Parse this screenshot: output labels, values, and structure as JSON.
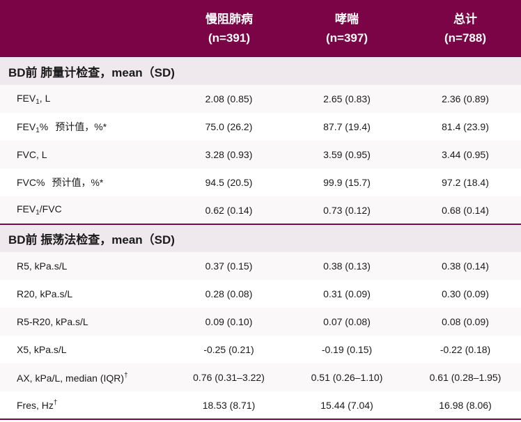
{
  "header": {
    "col1_line1": "慢阻肺病",
    "col1_line2": "(n=391)",
    "col2_line1": "哮喘",
    "col2_line2": "(n=397)",
    "col3_line1": "总计",
    "col3_line2": "(n=788)"
  },
  "section1": {
    "title": "BD前 肺量计检查，mean（SD)"
  },
  "section2": {
    "title": "BD前 振荡法检查，mean（SD)"
  },
  "rows1": [
    {
      "label_a": "FEV",
      "label_sub": "1",
      "label_b": ", L",
      "v1": "2.08 (0.85)",
      "v2": "2.65 (0.83)",
      "v3": "2.36 (0.89)"
    },
    {
      "label_a": "FEV",
      "label_sub": "1",
      "label_b": "%",
      "label_suffix": "预计值，%*",
      "v1": "75.0 (26.2)",
      "v2": "87.7 (19.4)",
      "v3": "81.4 (23.9)"
    },
    {
      "label_a": "FVC, L",
      "v1": "3.28 (0.93)",
      "v2": "3.59 (0.95)",
      "v3": "3.44 (0.95)"
    },
    {
      "label_a": "FVC%",
      "label_suffix": "预计值，%*",
      "v1": "94.5 (20.5)",
      "v2": "99.9 (15.7)",
      "v3": "97.2 (18.4)"
    },
    {
      "label_a": "FEV",
      "label_sub": "1",
      "label_b": "/FVC",
      "v1": "0.62 (0.14)",
      "v2": "0.73 (0.12)",
      "v3": "0.68 (0.14)"
    }
  ],
  "rows2": [
    {
      "label_a": "R5, kPa.s/L",
      "v1": "0.37 (0.15)",
      "v2": "0.38 (0.13)",
      "v3": "0.38 (0.14)"
    },
    {
      "label_a": "R20, kPa.s/L",
      "v1": "0.28 (0.08)",
      "v2": "0.31 (0.09)",
      "v3": "0.30 (0.09)"
    },
    {
      "label_a": "R5-R20, kPa.s/L",
      "v1": "0.09 (0.10)",
      "v2": "0.07 (0.08)",
      "v3": "0.08 (0.09)"
    },
    {
      "label_a": "X5, kPa.s/L",
      "v1": "-0.25 (0.21)",
      "v2": "-0.19 (0.15)",
      "v3": "-0.22 (0.18)"
    },
    {
      "label_a": "AX, kPa/L, median (IQR)",
      "label_sup": "†",
      "v1": "0.76 (0.31–3.22)",
      "v2": "0.51 (0.26–1.10)",
      "v3": "0.61 (0.28–1.95)"
    },
    {
      "label_a": "Fres, Hz",
      "label_sup": "†",
      "v1": "18.53 (8.71)",
      "v2": "15.44 (7.04)",
      "v3": "16.98 (8.06)"
    }
  ],
  "colors": {
    "header_bg": "#7a0446",
    "section_bg": "#efe8ec"
  }
}
